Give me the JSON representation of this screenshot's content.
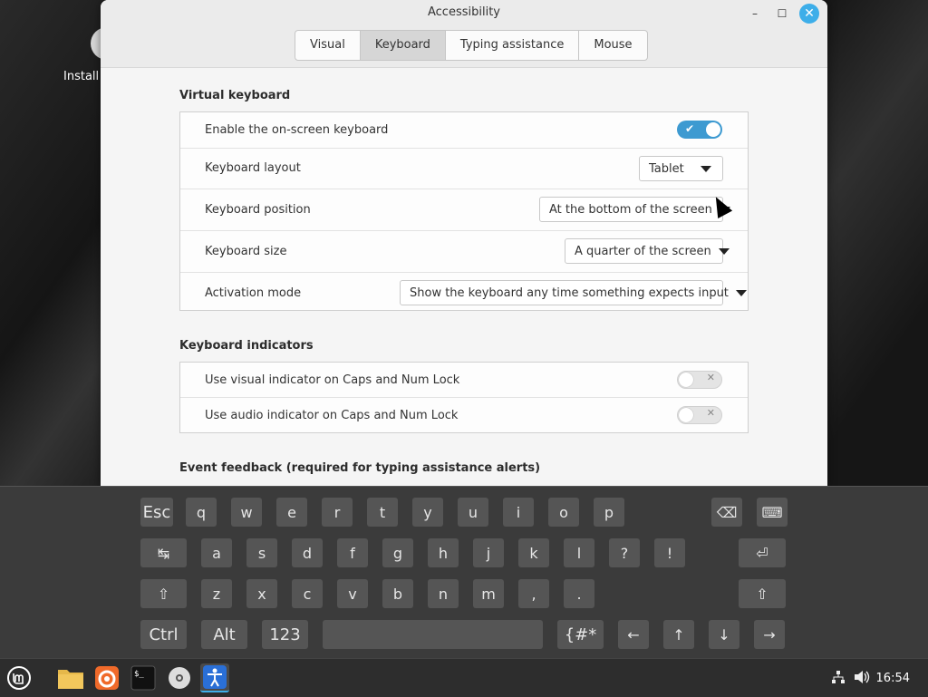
{
  "desktop": {
    "icon_label": "Install"
  },
  "window": {
    "title": "Accessibility",
    "controls": {
      "minimize": "–",
      "maximize": "☐",
      "close": "✕"
    },
    "tabs": [
      {
        "label": "Visual",
        "active": false
      },
      {
        "label": "Keyboard",
        "active": true
      },
      {
        "label": "Typing assistance",
        "active": false
      },
      {
        "label": "Mouse",
        "active": false
      }
    ]
  },
  "sections": {
    "virtual_keyboard": {
      "title": "Virtual keyboard",
      "enable_label": "Enable the on-screen keyboard",
      "enable_state": true,
      "layout_label": "Keyboard layout",
      "layout_value": "Tablet",
      "position_label": "Keyboard position",
      "position_value": "At the bottom of the screen",
      "size_label": "Keyboard size",
      "size_value": "A quarter of the screen",
      "activation_label": "Activation mode",
      "activation_value": "Show the keyboard any time something expects input"
    },
    "keyboard_indicators": {
      "title": "Keyboard indicators",
      "visual_label": "Use visual indicator on Caps and Num Lock",
      "visual_state": false,
      "audio_label": "Use audio indicator on Caps and Num Lock",
      "audio_state": false
    },
    "event_feedback": {
      "title": "Event feedback (required for typing assistance alerts)"
    }
  },
  "osk": {
    "row1": [
      "Esc",
      "q",
      "w",
      "e",
      "r",
      "t",
      "y",
      "u",
      "i",
      "o",
      "p",
      "⌫",
      "⌨"
    ],
    "row2": [
      "↹",
      "a",
      "s",
      "d",
      "f",
      "g",
      "h",
      "j",
      "k",
      "l",
      "?",
      "!",
      "⏎"
    ],
    "row3": [
      "⇧",
      "z",
      "x",
      "c",
      "v",
      "b",
      "n",
      "m",
      ",",
      ".",
      "⇧"
    ],
    "row4": [
      "Ctrl",
      "Alt",
      "123",
      "",
      "{#*",
      "←",
      "↑",
      "↓",
      "→"
    ]
  },
  "taskbar": {
    "time": "16:54",
    "network_icon": "network-icon",
    "volume_icon": "volume-icon"
  },
  "colors": {
    "accent": "#3daee9",
    "toggle_on": "#3d9ad1"
  }
}
